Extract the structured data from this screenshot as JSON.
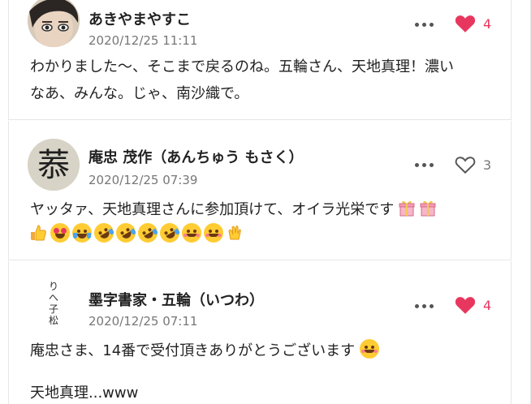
{
  "comments": [
    {
      "username": "あきやまやすこ",
      "timestamp": "2020/12/25 11:11",
      "likes": "4",
      "liked": true,
      "avatar": "profile-photo",
      "body_line1": "わかりました〜、そこまで戻るのね。五輪さん、天地真理！濃い",
      "body_line2": "なあ、みんな。じゃ、南沙織で。"
    },
    {
      "username": "庵忠 茂作（あんちゅう もさく）",
      "timestamp": "2020/12/25 07:39",
      "likes": "3",
      "liked": false,
      "avatar": "calligraphy-character",
      "avatar_char": "菾",
      "body_line1": "ヤッタァ、天地真理さんに参加頂けて、オイラ光栄です",
      "emojis": [
        "thumbs-up",
        "heart-eyes",
        "tears-of-joy",
        "rofl",
        "rofl",
        "rofl",
        "rofl",
        "smiling-hearts",
        "smiling-hearts",
        "clapping-hands"
      ],
      "gift_emojis": [
        "gift-icon",
        "gift-icon"
      ]
    },
    {
      "username": "墨字書家・五輪（いつわ）",
      "timestamp": "2020/12/25 07:11",
      "likes": "4",
      "liked": true,
      "avatar": "vertical-calligraphy",
      "avatar_chars": "りへ子松",
      "body_line1": "庵忠さま、14番で受付頂きありがとうございます",
      "body_line2": "天地真理...www"
    }
  ],
  "colors": {
    "like_active": "#e8375f",
    "like_inactive": "#555555",
    "timestamp": "#777777",
    "divider": "#e6e6e6"
  }
}
